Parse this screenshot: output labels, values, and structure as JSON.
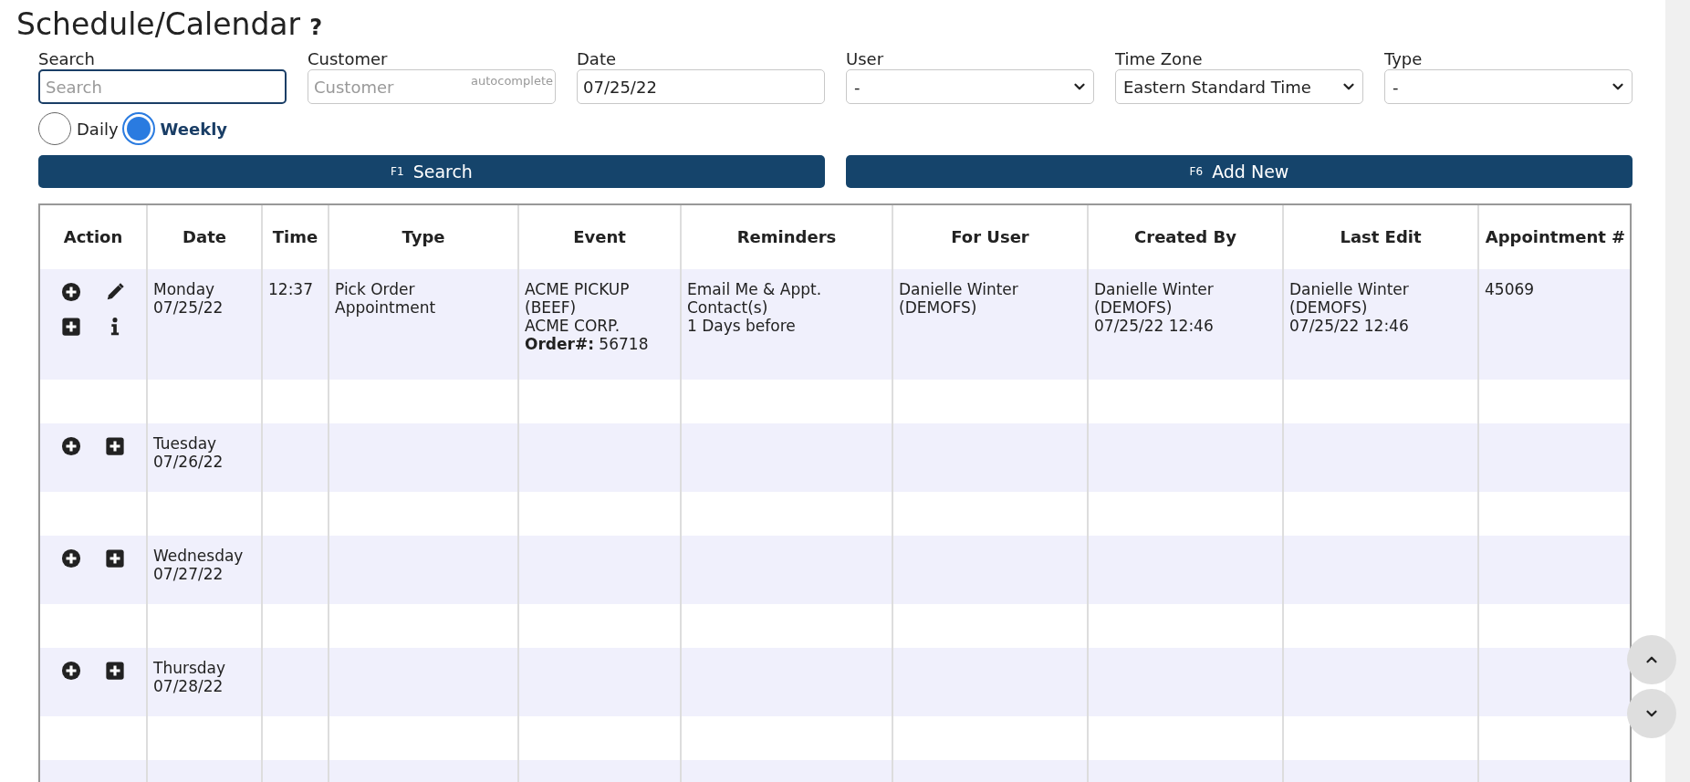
{
  "title": "Schedule/Calendar",
  "help": "?",
  "filters": [
    {
      "kind": "text",
      "label": "Search",
      "placeholder": "Search",
      "focused": true
    },
    {
      "kind": "text",
      "label": "Customer",
      "placeholder": "Customer",
      "hint": "autocomplete",
      "focused": false
    },
    {
      "kind": "text",
      "label": "Date",
      "value": "07/25/22",
      "focused": false
    },
    {
      "kind": "select",
      "label": "User",
      "value": "-"
    },
    {
      "kind": "select",
      "label": "Time Zone",
      "value": "Eastern Standard Time"
    },
    {
      "kind": "select",
      "label": "Type",
      "value": "-"
    }
  ],
  "views": [
    {
      "label": "Daily",
      "selected": false
    },
    {
      "label": "Weekly",
      "selected": true
    }
  ],
  "buttons": [
    {
      "key": "F1",
      "label": "Search"
    },
    {
      "key": "F6",
      "label": "Add New"
    }
  ],
  "table": {
    "columns": [
      "Action",
      "Date",
      "Time",
      "Type",
      "Event",
      "Reminders",
      "For User",
      "Created By",
      "Last Edit",
      "Appointment #"
    ],
    "rows": [
      {
        "cells": [
          [
            {
              "kind": "add-circle"
            },
            {
              "kind": "edit"
            },
            {
              "kind": "add-square"
            },
            {
              "kind": "info"
            }
          ],
          [
            "Monday",
            "07/25/22"
          ],
          [
            "12:37"
          ],
          [
            "Pick Order",
            "Appointment"
          ],
          [
            "ACME PICKUP",
            "(BEEF)",
            "ACME CORP.",
            "**Order#:** 56718"
          ],
          [
            "Email Me & Appt.",
            "Contact(s)",
            "1 Days before"
          ],
          [
            "Danielle Winter",
            "(DEMOFS)"
          ],
          [
            "Danielle Winter",
            "(DEMOFS)",
            "07/25/22 12:46"
          ],
          [
            "Danielle Winter",
            "(DEMOFS)",
            "07/25/22 12:46"
          ],
          [
            "45069"
          ]
        ]
      },
      {
        "cells": [
          [
            {
              "kind": "add-circle"
            },
            {
              "kind": "add-square"
            }
          ],
          [
            "Tuesday",
            "07/26/22"
          ],
          [],
          [],
          [],
          [],
          [],
          [],
          [],
          []
        ]
      },
      {
        "cells": [
          [
            {
              "kind": "add-circle"
            },
            {
              "kind": "add-square"
            }
          ],
          [
            "Wednesday",
            "07/27/22"
          ],
          [],
          [],
          [],
          [],
          [],
          [],
          [],
          []
        ]
      },
      {
        "cells": [
          [
            {
              "kind": "add-circle"
            },
            {
              "kind": "add-square"
            }
          ],
          [
            "Thursday",
            "07/28/22"
          ],
          [],
          [],
          [],
          [],
          [],
          [],
          [],
          []
        ]
      }
    ]
  }
}
